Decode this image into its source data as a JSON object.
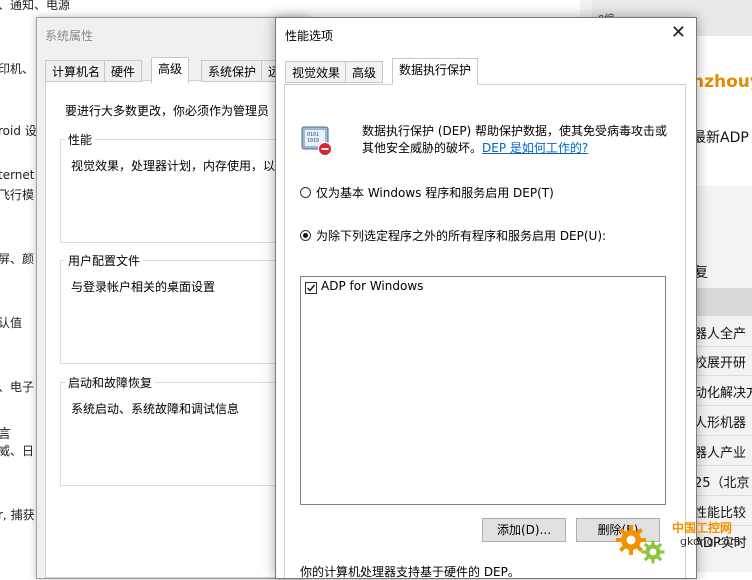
{
  "background_left": {
    "fragments": [
      "、通知、电源",
      "印机、",
      "roid 设",
      "ternet",
      "飞行模",
      "屏、颜",
      "认值",
      "、电子",
      "言",
      "威、日",
      "r, 捕获"
    ]
  },
  "background_right": {
    "top_text": "0编",
    "brand": "nzhouy",
    "adp_text": "最新ADP",
    "fu_text": "复",
    "news": [
      "器人全产",
      "校展开研",
      "动化解决方",
      "人形机器",
      "器人产业",
      "25（北京",
      "性能比较",
      "ADP实时"
    ]
  },
  "system_properties": {
    "title": "系统属性",
    "tabs": [
      "计算机名",
      "硬件",
      "高级",
      "系统保护",
      "远"
    ],
    "admin_note": "要进行大多数更改，你必须作为管理员",
    "groups": [
      {
        "label": "性能",
        "desc": "视觉效果，处理器计划，内存使用，以"
      },
      {
        "label": "用户配置文件",
        "desc": "与登录帐户相关的桌面设置"
      },
      {
        "label": "启动和故障恢复",
        "desc": "系统启动、系统故障和调试信息"
      }
    ]
  },
  "performance_options": {
    "title": "性能选项",
    "close_glyph": "✕",
    "tabs": [
      "视觉效果",
      "高级",
      "数据执行保护"
    ],
    "description_line1": "数据执行保护 (DEP) 帮助保护数据，使其免受病毒攻击或",
    "description_line2": "其他安全威胁的破坏。",
    "link": "DEP 是如何工作的?",
    "option1": "仅为基本 Windows 程序和服务启用 DEP(T)",
    "option2": "为除下列选定程序之外的所有程序和服务启用 DEP(U):",
    "list_items": [
      {
        "label": "ADP for Windows",
        "checked": true
      }
    ],
    "add_button": "添加(D)...",
    "remove_button": "删除(E)",
    "footer": "你的计算机处理器支持基于硬件的 DEP。"
  },
  "watermark": {
    "text1": "中国工控网",
    "text2": "gkong.com"
  },
  "colors": {
    "accent": "#0066cc",
    "brand": "#e38c00",
    "watermark": "#f39200"
  }
}
